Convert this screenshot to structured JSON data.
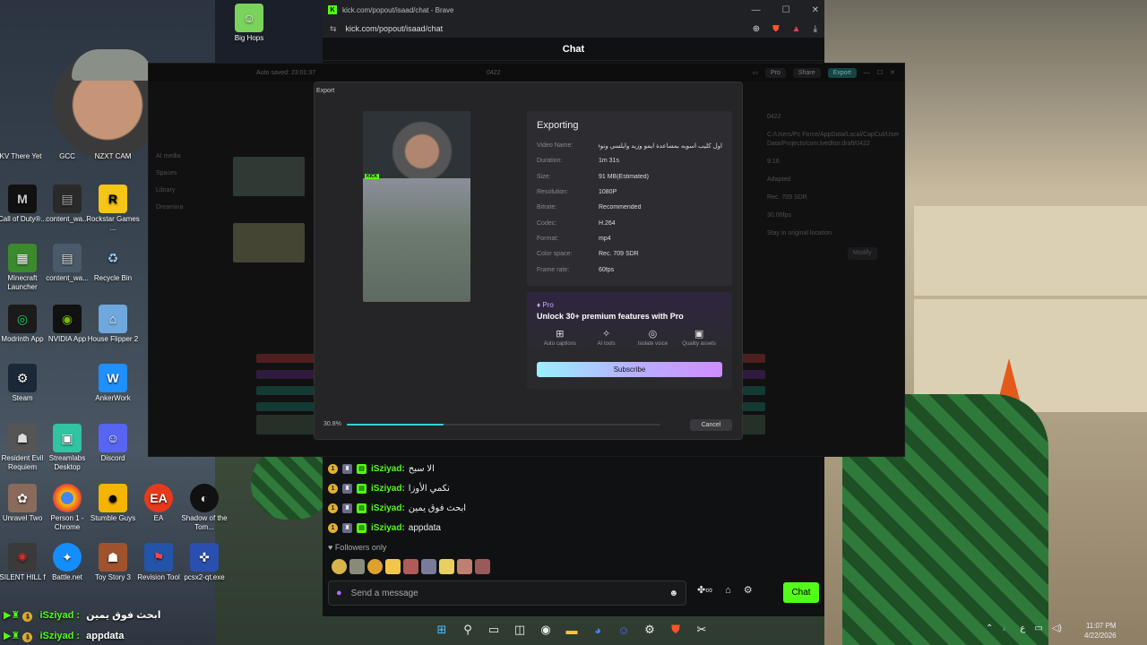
{
  "desktop": {
    "icons": [
      {
        "label": "KV There Yet"
      },
      {
        "label": "GCC"
      },
      {
        "label": "NZXT CAM"
      },
      {
        "label": "Call of Duty®..."
      },
      {
        "label": "content_wa..."
      },
      {
        "label": "Rockstar Games ..."
      },
      {
        "label": "Minecraft Launcher"
      },
      {
        "label": "content_wa..."
      },
      {
        "label": "Recycle Bin"
      },
      {
        "label": "Modrinth App"
      },
      {
        "label": "NVIDIA App"
      },
      {
        "label": "House Flipper 2"
      },
      {
        "label": "Steam"
      },
      {
        "label": "AnkerWork"
      },
      {
        "label": "Resident Evil Requiem"
      },
      {
        "label": "Streamlabs Desktop"
      },
      {
        "label": "Discord"
      },
      {
        "label": "Unravel Two"
      },
      {
        "label": "Person 1 - Chrome"
      },
      {
        "label": "Stumble Guys"
      },
      {
        "label": "EA"
      },
      {
        "label": "Shadow of the Tom..."
      },
      {
        "label": "SILENT HILL f"
      },
      {
        "label": "Battle.net"
      },
      {
        "label": "Toy Story 3"
      },
      {
        "label": "Revision Tool"
      },
      {
        "label": "pcsx2-qt.exe"
      },
      {
        "label": "Big Hops"
      }
    ]
  },
  "browser": {
    "title": "kick.com/popout/isaad/chat - Brave",
    "url": "kick.com/popout/isaad/chat",
    "page_title": "Chat"
  },
  "capcut": {
    "autosave": "Auto saved: 23:01:37",
    "project": "0422",
    "pro_label": "Pro",
    "share_label": "Share",
    "export_label": "Export",
    "side": [
      "AI media",
      "Spaces",
      "Library",
      "Dreamina"
    ],
    "right_panel": {
      "name": "0422",
      "path": "C:/Users/Pc Force/AppData/Local/CapCut/User Data/Projects/com.lveditor.draft/0422",
      "ratio": "9:16",
      "adapted": "Adapted",
      "color": "Rec. 709 SDR",
      "fps": "30.00fps",
      "location": "Stay in original location",
      "modify": "Modify"
    }
  },
  "export_dialog": {
    "title": "Export",
    "heading": "Exporting",
    "rows": [
      {
        "k": "Video Name:",
        "v": "اول كليب اسويه بمساعدة ايمو وزيد وايلسي ونوف وار"
      },
      {
        "k": "Duration:",
        "v": "1m 31s"
      },
      {
        "k": "Size:",
        "v": "91 MB(Estimated)"
      },
      {
        "k": "Resolution:",
        "v": "1080P"
      },
      {
        "k": "Bitrate:",
        "v": "Recommended"
      },
      {
        "k": "Codec:",
        "v": "H.264"
      },
      {
        "k": "Format:",
        "v": "mp4"
      },
      {
        "k": "Color space:",
        "v": "Rec. 709 SDR"
      },
      {
        "k": "Frame rate:",
        "v": "60fps"
      }
    ],
    "pro_badge": "Pro",
    "pro_headline": "Unlock 30+ premium features with Pro",
    "features": [
      {
        "icon": "captions-icon",
        "glyph": "⊞",
        "label": "Auto captions"
      },
      {
        "icon": "ai-tools-icon",
        "glyph": "✧",
        "label": "AI tools"
      },
      {
        "icon": "isolate-voice-icon",
        "glyph": "◎",
        "label": "Isolate voice"
      },
      {
        "icon": "quality-assets-icon",
        "glyph": "▣",
        "label": "Quality assets"
      }
    ],
    "subscribe_label": "Subscribe",
    "progress_text": "30.8%",
    "progress": 0.308,
    "cancel_label": "Cancel",
    "preview_tag": "KICK"
  },
  "chat": {
    "messages": [
      {
        "user": "iSziyad:",
        "text": "الا سبح"
      },
      {
        "user": "iSziyad:",
        "text": "نكمي الأوزا"
      },
      {
        "user": "iSziyad:",
        "text": "ابحث فوق يمين"
      },
      {
        "user": "iSziyad:",
        "text": "appdata"
      }
    ],
    "followers_only": "Followers only",
    "input_placeholder": "Send a message",
    "chat_button": "Chat"
  },
  "overlay_chat": [
    {
      "user": "iSziyad :",
      "text": "ابحث فوق يمين"
    },
    {
      "user": "iSziyad :",
      "text": "appdata"
    }
  ],
  "taskbar": {
    "time": "11:07 PM",
    "date": "4/22/2026",
    "lang": "ع"
  },
  "colors": {
    "kick_green": "#53fc18",
    "capcut_accent": "#3ad1d1"
  }
}
